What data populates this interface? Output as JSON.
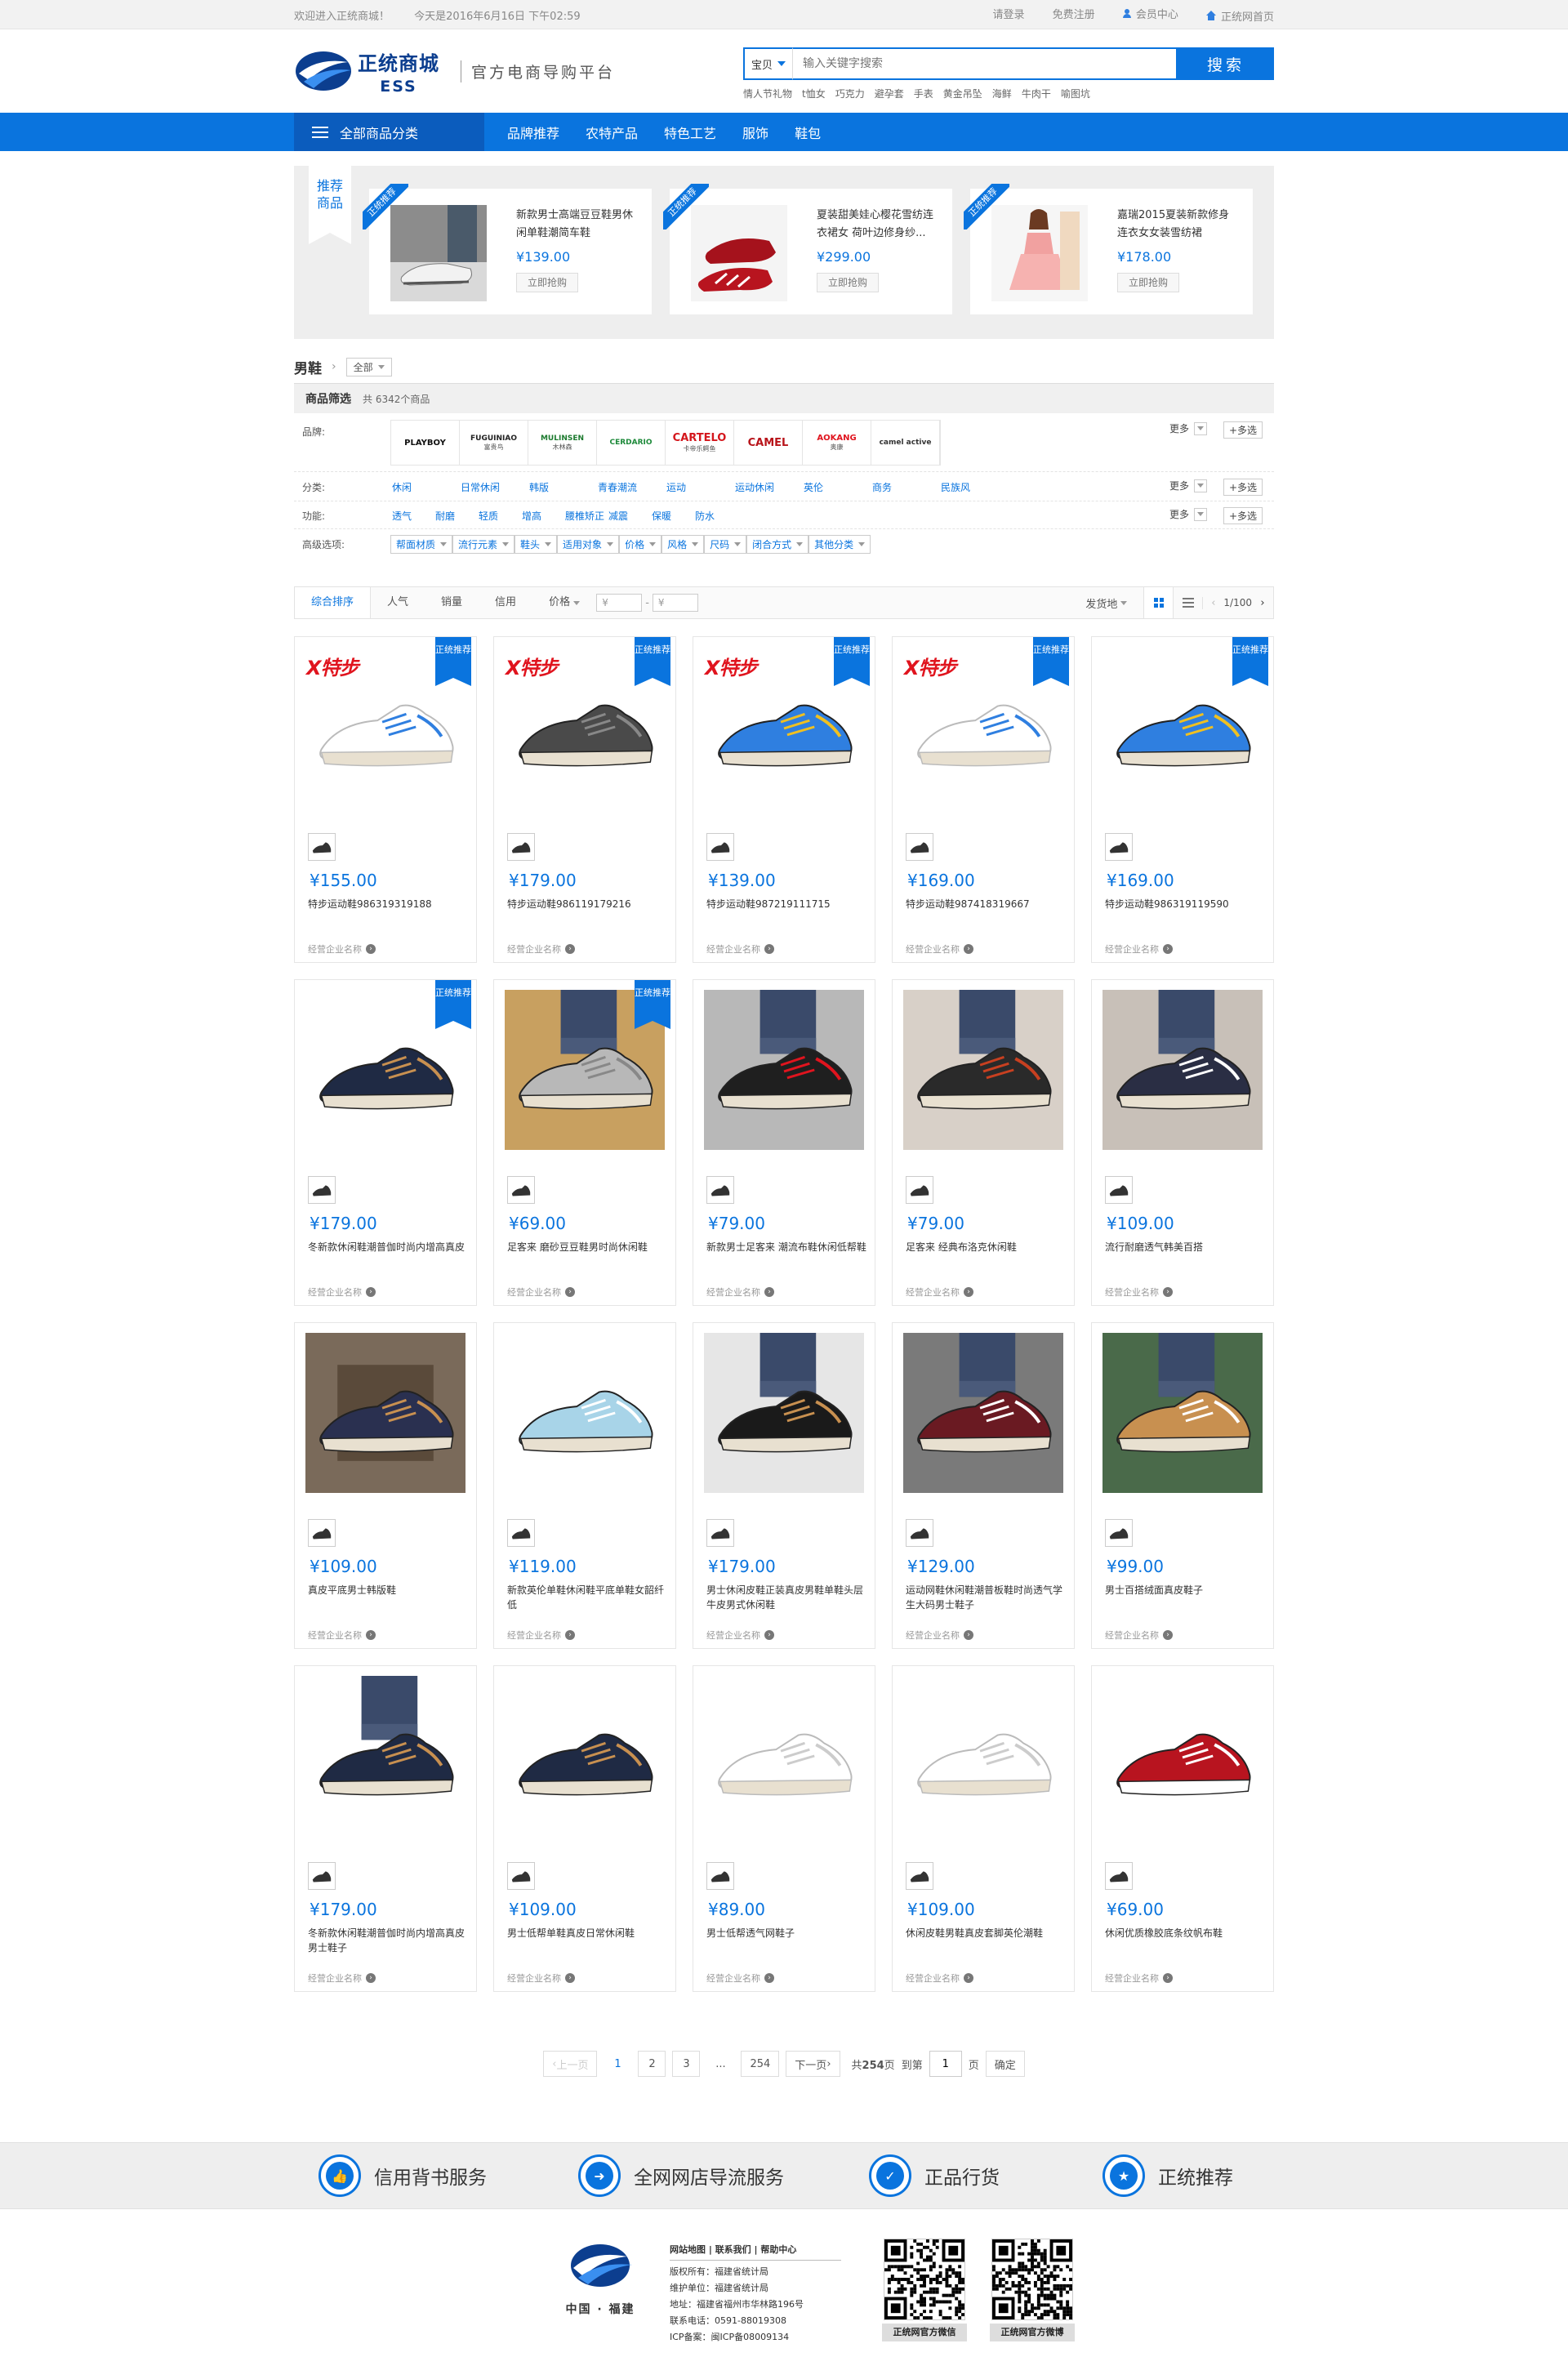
{
  "topbar": {
    "welcome": "欢迎进入正统商城！",
    "date_time": "今天是2016年6月16日 下午02:59",
    "login": "请登录",
    "register": "免费注册",
    "member": "会员中心",
    "home": "正统网首页"
  },
  "header": {
    "logo_cn": "正统商城",
    "logo_en": "ESS",
    "slogan": "官方电商导购平台",
    "search_scope": "宝贝",
    "search_placeholder": "输入关键字搜索",
    "search_button": "搜索",
    "hot_words": [
      "情人节礼物",
      "t恤女",
      "巧克力",
      "避孕套",
      "手表",
      "黄金吊坠",
      "海鲜",
      "牛肉干",
      "喻图坑"
    ]
  },
  "nav": {
    "all_categories": "全部商品分类",
    "items": [
      "品牌推荐",
      "农特产品",
      "特色工艺",
      "服饰",
      "鞋包"
    ]
  },
  "recommend": {
    "ribbon": [
      "推荐",
      "商品"
    ],
    "tag": "正统推荐",
    "cards": [
      {
        "title": "新款男士高端豆豆鞋男休闲单鞋潮简车鞋",
        "price": "¥139.00",
        "buy": "立即抢购"
      },
      {
        "title": "夏装甜美娃心樱花雪纺连衣裙女 荷叶边修身纱...",
        "price": "¥299.00",
        "buy": "立即抢购"
      },
      {
        "title": "嘉瑞2015夏装新款修身连衣女女装雪纺裙",
        "price": "¥178.00",
        "buy": "立即抢购"
      }
    ]
  },
  "breadcrumb": {
    "category": "男鞋",
    "scope": "全部"
  },
  "filter": {
    "title": "商品筛选",
    "count": "共 6342个商品",
    "brand_label": "品牌:",
    "brands": [
      "PLAYBOY",
      "FUGUINIAO",
      "MULINSEN",
      "CERDARIO",
      "CARTELO",
      "CAMEL",
      "AOKANG",
      "camel active"
    ],
    "brand_sub": [
      "",
      "富贵鸟",
      "木林森",
      "",
      "卡帝乐鳄鱼",
      "",
      "奥康",
      ""
    ],
    "category_label": "分类:",
    "categories": [
      "休闲",
      "日常休闲",
      "韩版",
      "青春潮流",
      "运动",
      "运动休闲",
      "英伦",
      "商务",
      "民族风"
    ],
    "function_label": "功能:",
    "functions": [
      "透气",
      "耐磨",
      "轻质",
      "增高",
      "腰椎矫正",
      "减震",
      "保暖",
      "防水"
    ],
    "advanced_label": "高级选项:",
    "advanced": [
      "帮面材质",
      "流行元素",
      "鞋头",
      "适用对象",
      "价格",
      "风格",
      "尺码",
      "闭合方式",
      "其他分类"
    ],
    "more": "更多",
    "multi": "+多选"
  },
  "sort": {
    "items": [
      "综合排序",
      "人气",
      "销量",
      "信用",
      "价格"
    ],
    "price_from": "¥",
    "price_to": "¥",
    "ship_from": "发货地",
    "page": "1/100"
  },
  "badge_text": "正统推荐",
  "shop_label": "经营企业名称",
  "products": [
    {
      "price": "¥155.00",
      "name": "特步运动鞋986319319188",
      "badge": true,
      "xtep": true
    },
    {
      "price": "¥179.00",
      "name": "特步运动鞋986119179216",
      "badge": true,
      "xtep": true
    },
    {
      "price": "¥139.00",
      "name": "特步运动鞋987219111715",
      "badge": true,
      "xtep": true
    },
    {
      "price": "¥169.00",
      "name": "特步运动鞋987418319667",
      "badge": true,
      "xtep": true
    },
    {
      "price": "¥169.00",
      "name": "特步运动鞋986319119590",
      "badge": true,
      "xtep": false
    },
    {
      "price": "¥179.00",
      "name": "冬新款休闲鞋潮普伽时尚内增高真皮",
      "badge": true,
      "xtep": false
    },
    {
      "price": "¥69.00",
      "name": "足客来 磨砂豆豆鞋男时尚休闲鞋",
      "badge": true,
      "xtep": false
    },
    {
      "price": "¥79.00",
      "name": "新款男士足客来 潮流布鞋休闲低帮鞋",
      "badge": false,
      "xtep": false
    },
    {
      "price": "¥79.00",
      "name": "足客来 经典布洛克休闲鞋",
      "badge": false,
      "xtep": false
    },
    {
      "price": "¥109.00",
      "name": "流行耐磨透气韩美百搭",
      "badge": false,
      "xtep": false
    },
    {
      "price": "¥109.00",
      "name": "真皮平底男士韩版鞋",
      "badge": false,
      "xtep": false
    },
    {
      "price": "¥119.00",
      "name": "新款英伦单鞋休闲鞋平底单鞋女韶纤低",
      "badge": false,
      "xtep": false
    },
    {
      "price": "¥179.00",
      "name": "男士休闲皮鞋正装真皮男鞋单鞋头层牛皮男式休闲鞋",
      "badge": false,
      "xtep": false
    },
    {
      "price": "¥129.00",
      "name": "运动网鞋休闲鞋潮普板鞋时尚透气学生大码男士鞋子",
      "badge": false,
      "xtep": false
    },
    {
      "price": "¥99.00",
      "name": "男士百搭绒面真皮鞋子",
      "badge": false,
      "xtep": false
    },
    {
      "price": "¥179.00",
      "name": "冬新款休闲鞋潮普伽时尚内增高真皮男士鞋子",
      "badge": false,
      "xtep": false
    },
    {
      "price": "¥109.00",
      "name": "男士低帮单鞋真皮日常休闲鞋",
      "badge": false,
      "xtep": false
    },
    {
      "price": "¥89.00",
      "name": "男士低帮透气网鞋子",
      "badge": false,
      "xtep": false
    },
    {
      "price": "¥109.00",
      "name": "休闲皮鞋男鞋真皮套脚英伦潮鞋",
      "badge": false,
      "xtep": false
    },
    {
      "price": "¥69.00",
      "name": "休闲优质橡胶底条纹帆布鞋",
      "badge": false,
      "xtep": false
    }
  ],
  "pager": {
    "prev": "上一页",
    "pages": [
      "1",
      "2",
      "3"
    ],
    "ellipsis": "...",
    "last": "254",
    "next": "下一页",
    "total_prefix": "共",
    "total": "254",
    "total_suffix": "页",
    "goto": "到第",
    "goto_value": "1",
    "goto_suffix": "页",
    "confirm": "确定"
  },
  "services": [
    "信用背书服务",
    "全网网店导流服务",
    "正品行货",
    "正统推荐"
  ],
  "footer": {
    "logo_cn": "中国 · 福建",
    "links": [
      "网站地图",
      "联系我们",
      "帮助中心"
    ],
    "lines": [
      "版权所有：福建省统计局",
      "维护单位：福建省统计局",
      "地址：福建省福州市华林路196号",
      "联系电话：0591-88019308",
      "ICP备案：闽ICP备08009134"
    ],
    "qr1": "正统网官方微信",
    "qr2": "正统网官方微博"
  },
  "colors": {
    "primary": "#0a74de",
    "dark_nav": "#0b5cbd",
    "price": "#0a74de",
    "xtep_red": "#e0141e"
  }
}
